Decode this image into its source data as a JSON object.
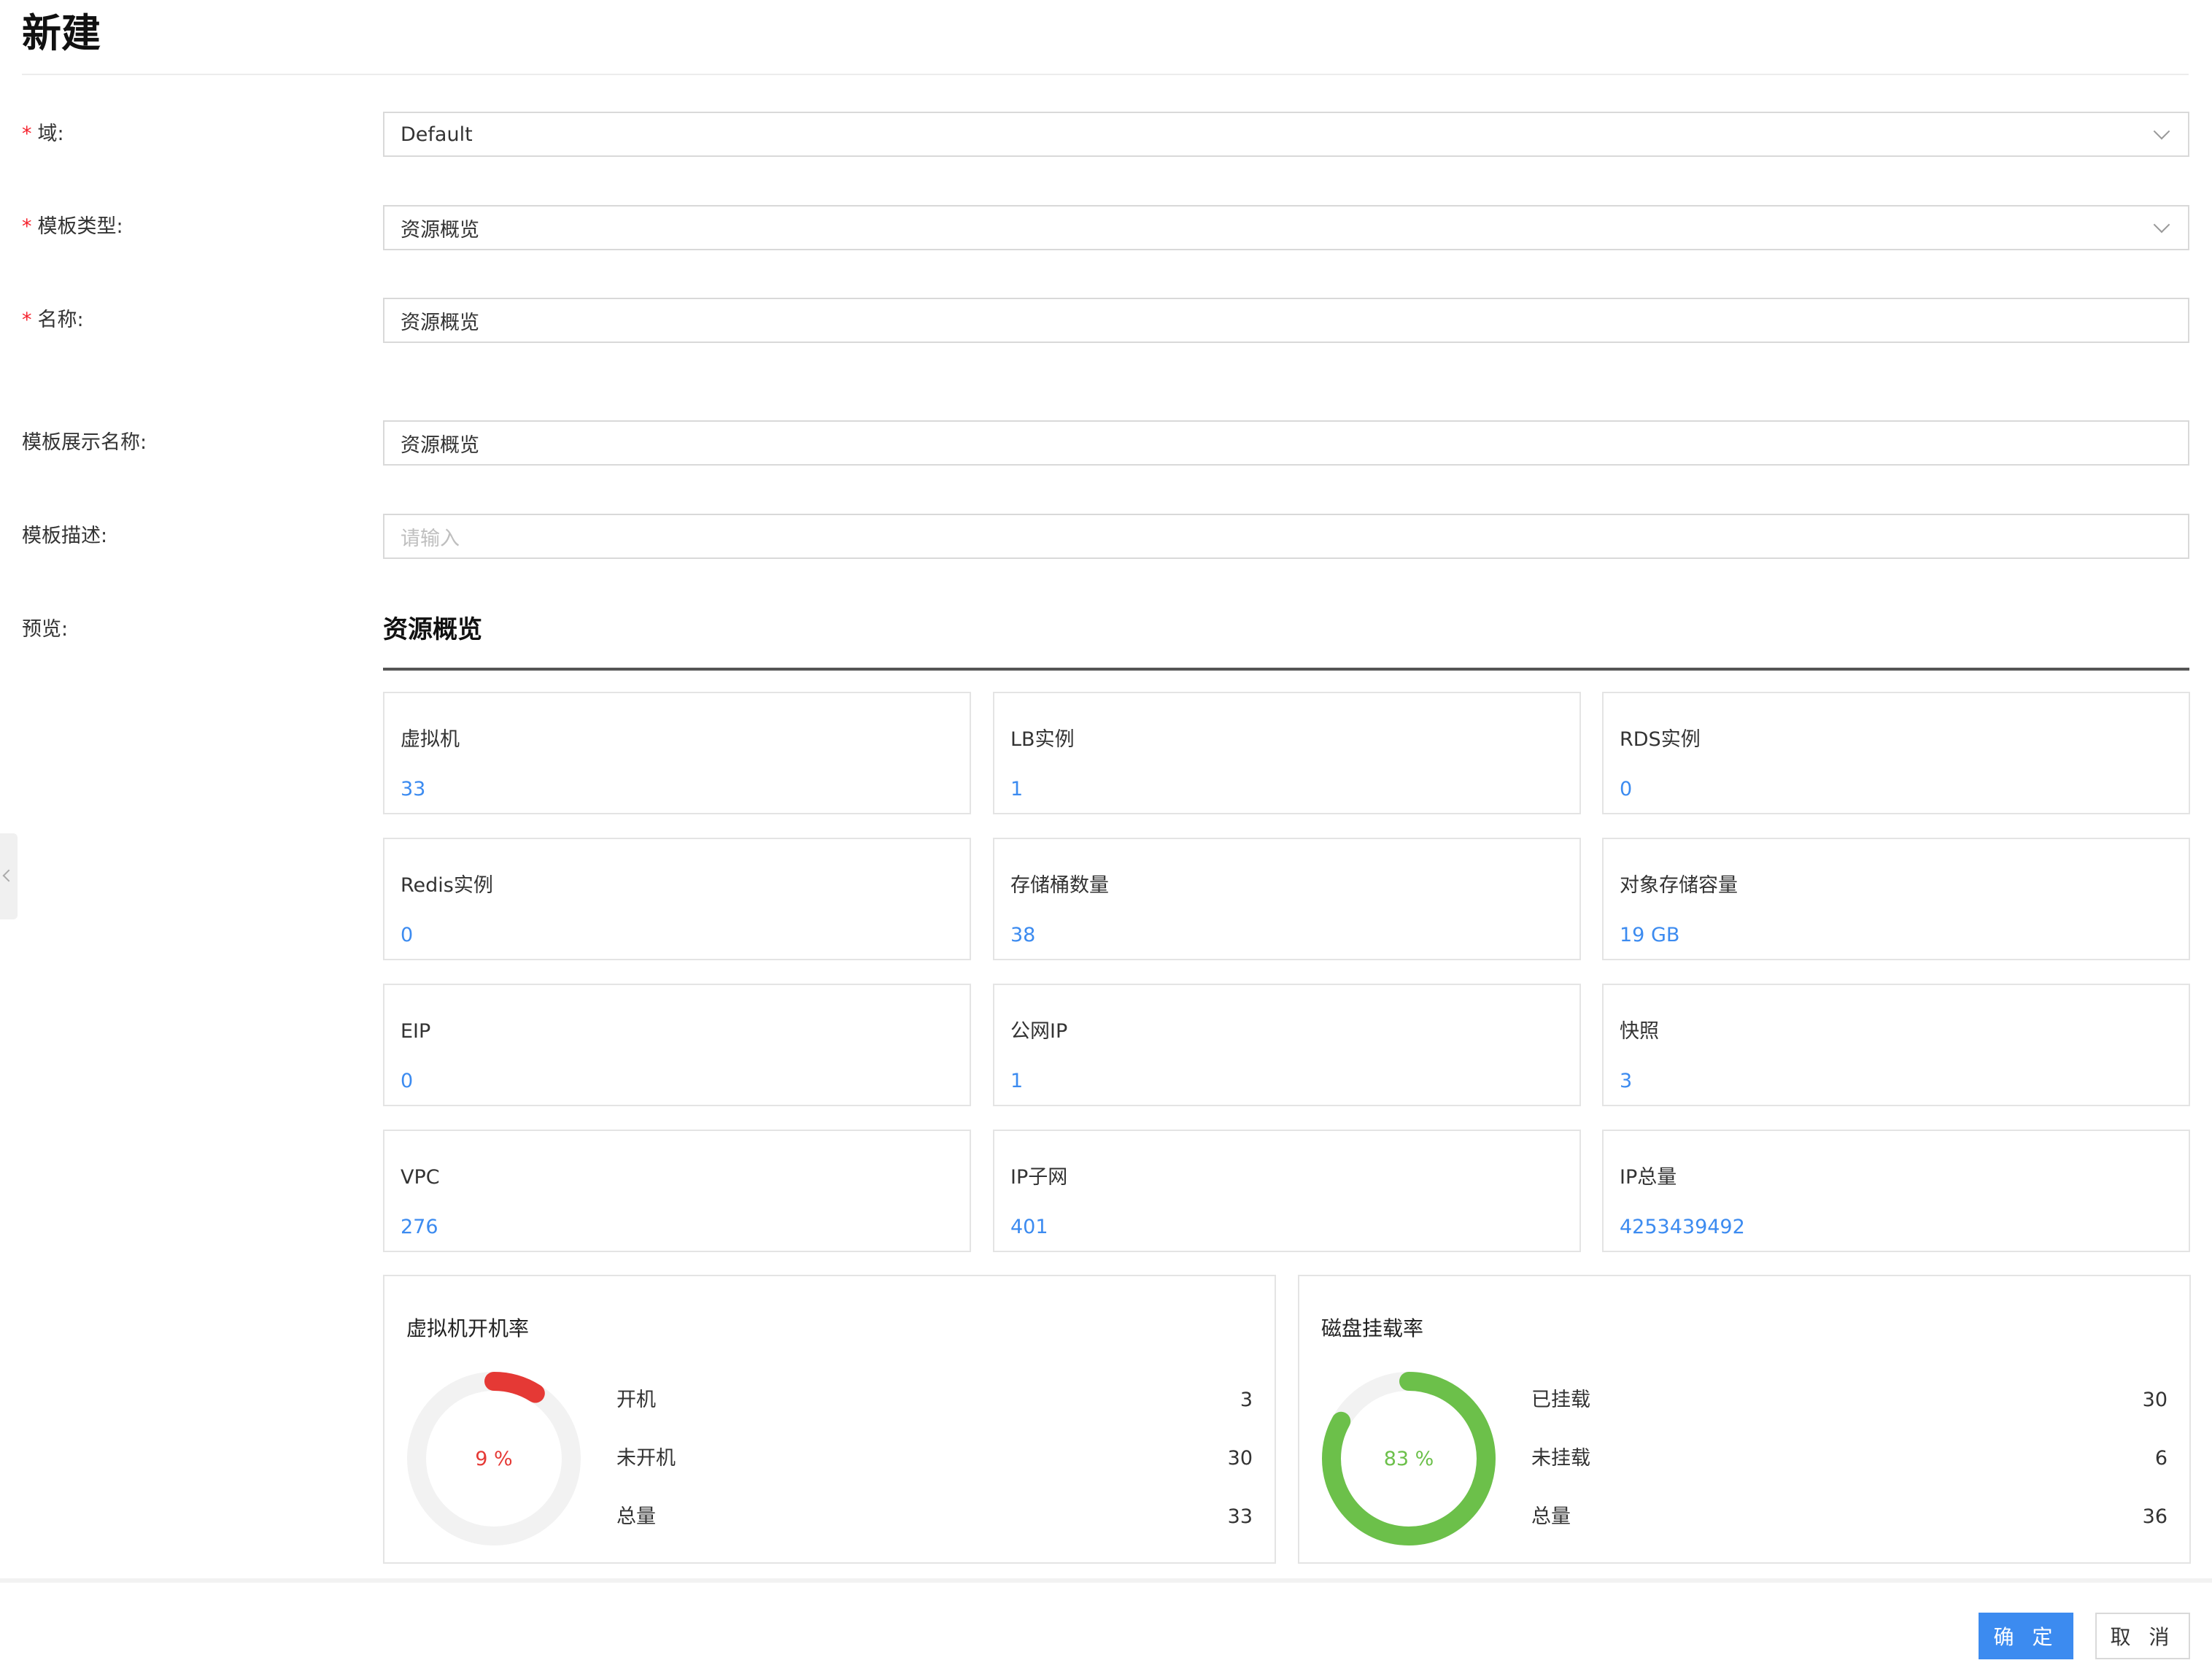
{
  "page": {
    "title": "新建"
  },
  "form": {
    "domain": {
      "label": "域:",
      "value": "Default"
    },
    "template_type": {
      "label": "模板类型:",
      "value": "资源概览"
    },
    "name": {
      "label": "名称:",
      "value": "资源概览"
    },
    "display_name": {
      "label": "模板展示名称:",
      "value": "资源概览"
    },
    "description": {
      "label": "模板描述:",
      "placeholder": "请输入"
    },
    "preview": {
      "label": "预览:"
    }
  },
  "preview": {
    "heading": "资源概览",
    "cards": [
      {
        "label": "虚拟机",
        "value": "33"
      },
      {
        "label": "LB实例",
        "value": "1"
      },
      {
        "label": "RDS实例",
        "value": "0"
      },
      {
        "label": "Redis实例",
        "value": "0"
      },
      {
        "label": "存储桶数量",
        "value": "38"
      },
      {
        "label": "对象存储容量",
        "value": "19 GB"
      },
      {
        "label": "EIP",
        "value": "0"
      },
      {
        "label": "公网IP",
        "value": "1"
      },
      {
        "label": "快照",
        "value": "3"
      },
      {
        "label": "VPC",
        "value": "276"
      },
      {
        "label": "IP子网",
        "value": "401"
      },
      {
        "label": "IP总量",
        "value": "4253439492"
      }
    ],
    "vm_power_rate": {
      "title": "虚拟机开机率",
      "percent_text": "9 %",
      "ratio": 0.09,
      "color": "#e53935",
      "stats": [
        {
          "name": "开机",
          "value": "3"
        },
        {
          "name": "未开机",
          "value": "30"
        },
        {
          "name": "总量",
          "value": "33"
        }
      ]
    },
    "disk_mount_rate": {
      "title": "磁盘挂载率",
      "percent_text": "83 %",
      "ratio": 0.83,
      "color": "#6cc04a",
      "stats": [
        {
          "name": "已挂载",
          "value": "30"
        },
        {
          "name": "未挂载",
          "value": "6"
        },
        {
          "name": "总量",
          "value": "36"
        }
      ]
    }
  },
  "footer": {
    "confirm_label": "确 定",
    "cancel_label": "取 消"
  }
}
